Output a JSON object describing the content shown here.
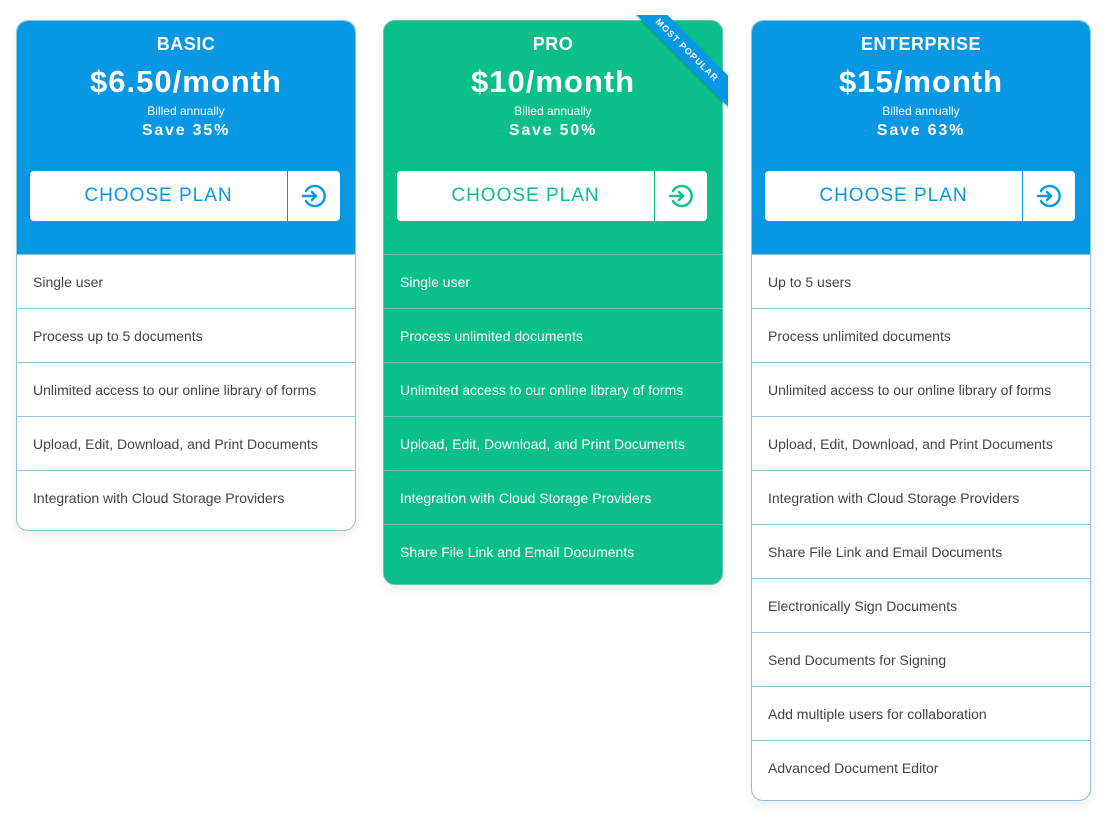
{
  "colors": {
    "blue": "#0898e3",
    "green": "#0bbf8a"
  },
  "plans": [
    {
      "name": "BASIC",
      "price": "$6.50/month",
      "billing": "Billed annually",
      "savings": "Save 35%",
      "cta": "CHOOSE PLAN",
      "cta_icon": "arrow-circle-right-icon",
      "features": [
        "Single user",
        "Process up to 5 documents",
        "Unlimited access to our online library of forms",
        "Upload, Edit, Download, and Print Documents",
        "Integration with Cloud Storage Providers"
      ]
    },
    {
      "name": "PRO",
      "badge": "MOST POPULAR",
      "price": "$10/month",
      "billing": "Billed annually",
      "savings": "Save 50%",
      "cta": "CHOOSE PLAN",
      "cta_icon": "arrow-circle-right-icon",
      "features": [
        "Single user",
        "Process unlimited documents",
        "Unlimited access to our online library of forms",
        "Upload, Edit, Download, and Print Documents",
        "Integration with Cloud Storage Providers",
        "Share File Link and Email Documents"
      ]
    },
    {
      "name": "ENTERPRISE",
      "price": "$15/month",
      "billing": "Billed annually",
      "savings": "Save 63%",
      "cta": "CHOOSE PLAN",
      "cta_icon": "arrow-circle-right-icon",
      "features": [
        "Up to 5 users",
        "Process unlimited documents",
        "Unlimited access to our online library of forms",
        "Upload, Edit, Download, and Print Documents",
        "Integration with Cloud Storage Providers",
        "Share File Link and Email Documents",
        "Electronically Sign Documents",
        "Send Documents for Signing",
        "Add multiple users for collaboration",
        "Advanced Document Editor"
      ]
    }
  ]
}
